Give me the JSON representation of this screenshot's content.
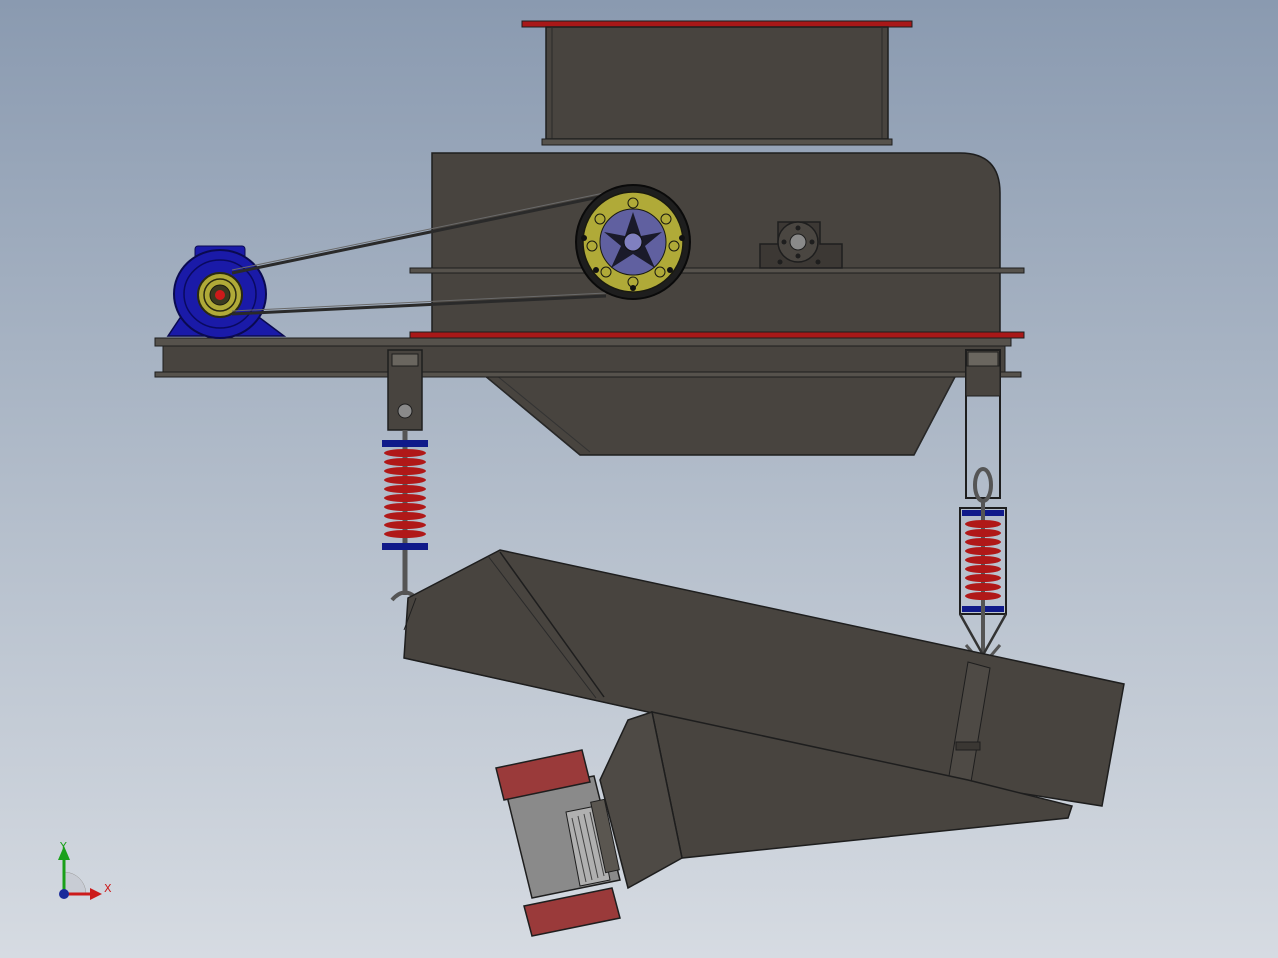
{
  "axis_triad": {
    "x_label": "X",
    "y_label": "Y",
    "x_color": "#cc1a1a",
    "y_color": "#1aa01a",
    "origin_color": "#1a2a9a"
  },
  "colors": {
    "body": "#48443f",
    "body_edge": "#1e1e1e",
    "flange_red": "#a81818",
    "motor_blue": "#1a1aa8",
    "pulley_yellow": "#b0aa38",
    "spring_red": "#b01818",
    "spring_cap_blue": "#101a8a",
    "vibrator_red": "#9a3a3a",
    "vibrator_grey": "#8a8a8a"
  }
}
